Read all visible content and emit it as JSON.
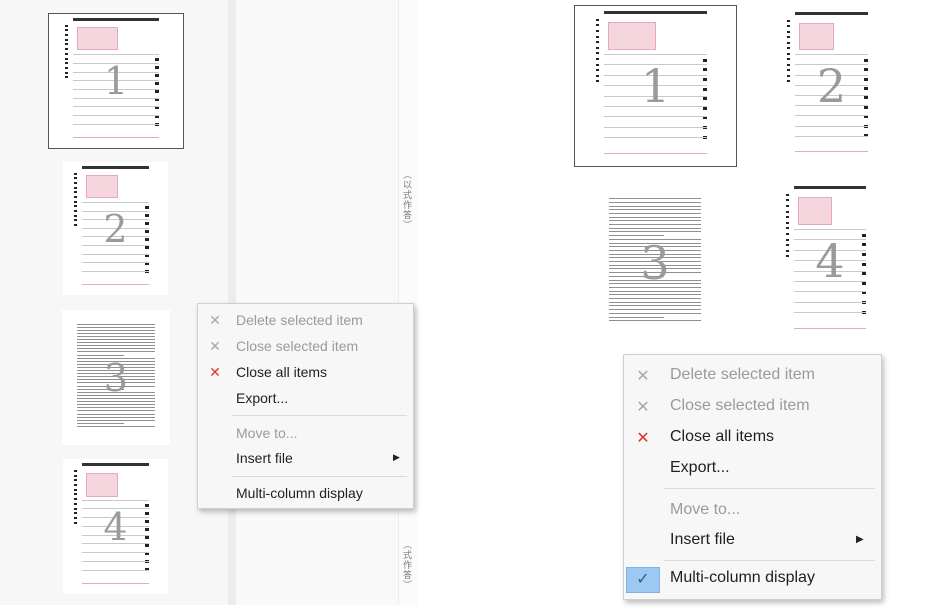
{
  "pages": [
    {
      "number": "1",
      "kind": "answer-sheet",
      "selected": true
    },
    {
      "number": "2",
      "kind": "answer-sheet",
      "selected": false
    },
    {
      "number": "3",
      "kind": "text-page",
      "selected": false
    },
    {
      "number": "4",
      "kind": "answer-sheet",
      "selected": false
    }
  ],
  "side_text": [
    "（以式作答）",
    "（式作答）"
  ],
  "menu": {
    "items": [
      {
        "label": "Delete selected item",
        "icon": "close-icon",
        "icon_color": "#a8a8a8",
        "enabled": false
      },
      {
        "label": "Close selected item",
        "icon": "close-icon",
        "icon_color": "#a8a8a8",
        "enabled": false
      },
      {
        "label": "Close all items",
        "icon": "close-icon",
        "icon_color": "#e0352b",
        "enabled": true
      },
      {
        "label": "Export...",
        "enabled": true
      },
      {
        "label": "Move to...",
        "enabled": false
      },
      {
        "label": "Insert file",
        "enabled": true,
        "submenu": true
      },
      {
        "label": "Multi-column display",
        "enabled": true
      }
    ],
    "multi_column_checked_in_right": true
  },
  "colors": {
    "selection_check": "#9cc8f2",
    "close_all_icon": "#e0352b"
  },
  "glyphs": {
    "close": "✕",
    "chevron": "▶",
    "check": "✓"
  }
}
